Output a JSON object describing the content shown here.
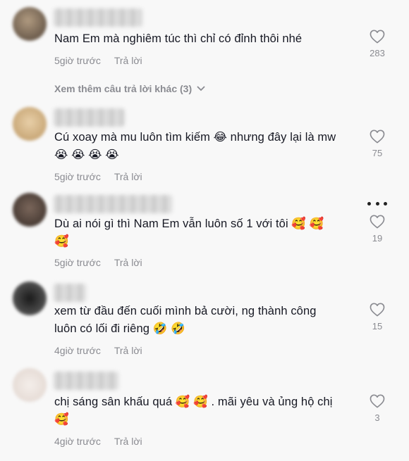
{
  "comments": [
    {
      "text": "Nam Em mà nghiêm túc thì chỉ có đỉnh thôi nhé",
      "time": "5giờ trước",
      "reply": "Trả lời",
      "likes": "283",
      "avatar_color": "#8a7a66"
    },
    {
      "text": "Cú xoay mà mu luôn tìm kiếm 😂 nhưng đây lại là mw 😭 😭 😭 😭",
      "time": "5giờ trước",
      "reply": "Trả lời",
      "likes": "75",
      "avatar_color": "#d8b98a"
    },
    {
      "text": "Dù ai nói gì thì Nam Em vẫn luôn số 1 với tôi 🥰 🥰 🥰",
      "time": "5giờ trước",
      "reply": "Trả lời",
      "likes": "19",
      "avatar_color": "#5e4d44"
    },
    {
      "text": "xem từ đầu đến cuối mình bả cười, ng thành công luôn có lối đi riêng 🤣 🤣",
      "time": "4giờ trước",
      "reply": "Trả lời",
      "likes": "15",
      "avatar_color": "#3a3a3a"
    },
    {
      "text": "chị sáng sân khấu quá 🥰 🥰 . mãi yêu và ủng hộ chị 🥰",
      "time": "4giờ trước",
      "reply": "Trả lời",
      "likes": "3",
      "avatar_color": "#ece4df"
    }
  ],
  "view_more": "Xem thêm câu trả lời khác (3)"
}
